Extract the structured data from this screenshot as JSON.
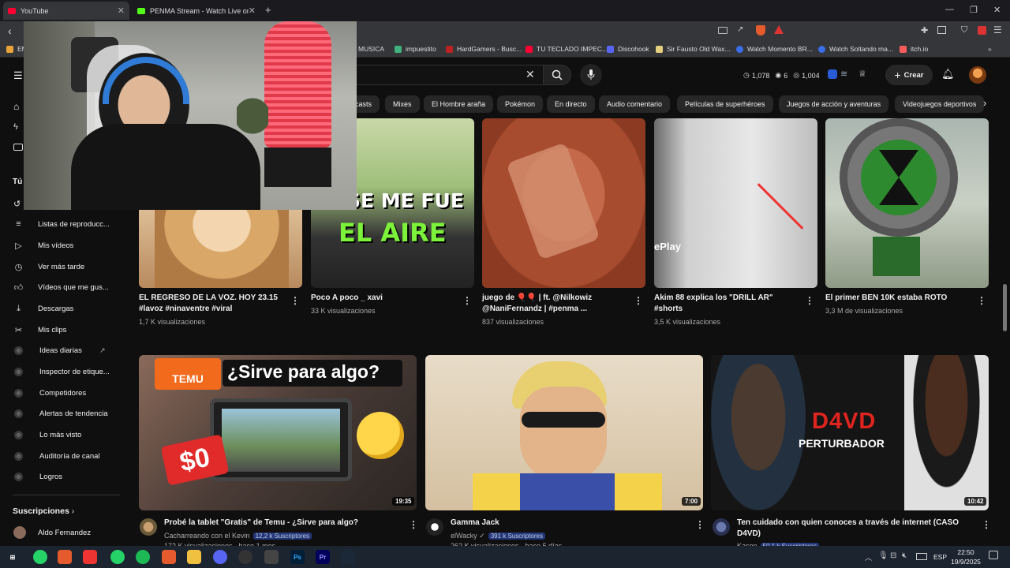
{
  "browser": {
    "tabs": [
      {
        "label": "YouTube",
        "color": "#ff0033"
      },
      {
        "label": "PENMA Stream - Watch Live on K",
        "color": "#53fc18"
      }
    ],
    "new_tab": "+",
    "bookmarks": [
      {
        "label": "EM",
        "color": "#e8a33a"
      },
      {
        "label": "MUSICA",
        "color": "#e8a33a"
      },
      {
        "label": "impuestito",
        "color": "#3fb27f"
      },
      {
        "label": "HardGamers - Busc...",
        "color": "#b22"
      },
      {
        "label": "TU TECLADO IMPEC...",
        "color": "#ff0033"
      },
      {
        "label": "Discohook",
        "color": "#5865f2"
      },
      {
        "label": "Sir Fausto Old Wax...",
        "color": "#e5d080"
      },
      {
        "label": "Watch Momento BR...",
        "color": "#3a6ee8"
      },
      {
        "label": "Watch Soltando ma...",
        "color": "#3a6ee8"
      },
      {
        "label": "itch.io",
        "color": "#fa5c5c"
      }
    ]
  },
  "header": {
    "stats": {
      "views": "1,078",
      "eye": "6",
      "count": "1,004"
    },
    "create_label": "Crear"
  },
  "chips": [
    "casts",
    "Mixes",
    "El Hombre araña",
    "Pokémon",
    "En directo",
    "Audio comentario",
    "Películas de superhéroes",
    "Juegos de acción y aventuras",
    "Videojuegos deportivos"
  ],
  "sidebar": {
    "section_you": "Tú",
    "items": [
      {
        "label": "Listas de reproducc...",
        "icon": "playlist-icon"
      },
      {
        "label": "Mis vídeos",
        "icon": "video-icon"
      },
      {
        "label": "Ver más tarde",
        "icon": "clock-icon"
      },
      {
        "label": "Vídeos que me gus...",
        "icon": "like-icon"
      },
      {
        "label": "Descargas",
        "icon": "download-icon"
      },
      {
        "label": "Mis clips",
        "icon": "scissors-icon"
      },
      {
        "label": "Ideas diarias",
        "icon": "badge-icon"
      },
      {
        "label": "Inspector de etique...",
        "icon": "badge-icon"
      },
      {
        "label": "Competidores",
        "icon": "badge-icon"
      },
      {
        "label": "Alertas de tendencia",
        "icon": "badge-icon"
      },
      {
        "label": "Lo más visto",
        "icon": "badge-icon"
      },
      {
        "label": "Auditoría de canal",
        "icon": "badge-icon"
      },
      {
        "label": "Logros",
        "icon": "badge-icon"
      }
    ],
    "subs_title": "Suscripciones",
    "subs_first": "Aldo Fernandez"
  },
  "row1": [
    {
      "title": "EL REGRESO DE LA VOZ. HOY 23.15 #lavoz #ninaventre #viral",
      "meta": "1,7 K visualizaciones"
    },
    {
      "title": "Poco A poco _ xavi",
      "meta": "33 K visualizaciones",
      "overlay1": "SE ME FUE",
      "overlay2": "EL AIRE"
    },
    {
      "title": "juego de 🎈🎈 | ft. @Nilkowiz @NaniFernandz | #penma ...",
      "meta": "837 visualizaciones"
    },
    {
      "title": "Akim 88 explica los \"DRILL AR\" #shorts",
      "meta": "3,5 K visualizaciones"
    },
    {
      "title": "El primer BEN 10K estaba ROTO",
      "meta": "3,3 M de visualizaciones"
    }
  ],
  "row2": [
    {
      "title": "Probé la tablet \"Gratis\" de Temu - ¿Sirve para algo?",
      "channel": "Cacharreando con el Kevin",
      "subs": "12,2 k Suscriptores",
      "meta": "172 K visualizaciones · hace 1 mes",
      "duration": "19:35",
      "overlay_brand": "TEMU",
      "overlay_q": "¿Sirve para algo?",
      "overlay_price": "$0"
    },
    {
      "title": "Gamma Jack",
      "channel": "elWacky",
      "subs": "391 k Suscriptores",
      "meta": "262 K visualizaciones · hace 5 días",
      "duration": "7:00"
    },
    {
      "title": "Ten cuidado con quien conoces a través de internet (CASO D4VD)",
      "channel": "Kason",
      "subs": "50,1 k Suscriptores",
      "meta": "",
      "duration": "10:42",
      "overlay1": "D4VD",
      "overlay2": "PERTURBADOR"
    }
  ],
  "taskbar": {
    "lang": "ESP",
    "time": "22:50",
    "date": "19/9/2025"
  }
}
